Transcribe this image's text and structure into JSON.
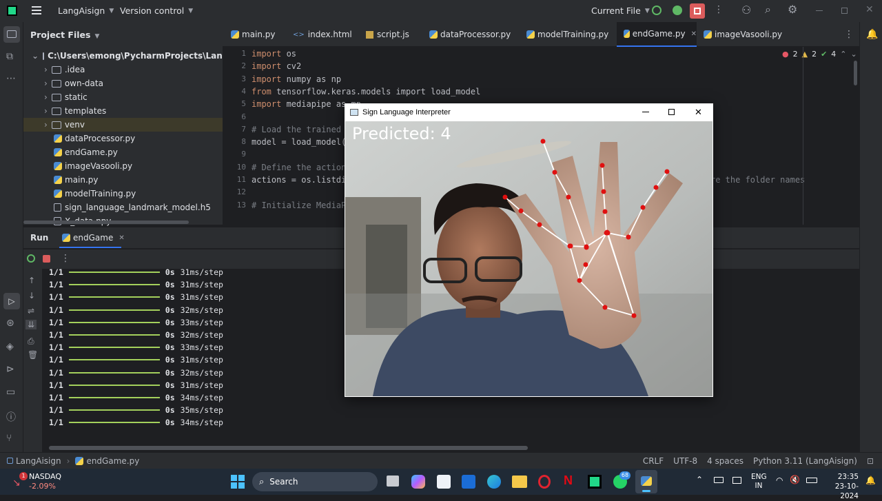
{
  "topbar": {
    "project": "LangAisign",
    "vcs": "Version control",
    "run_config": "Current File"
  },
  "project_panel": {
    "title": "Project Files",
    "root": "C:\\Users\\emong\\PycharmProjects\\LangAis",
    "folders": [
      ".idea",
      "own-data",
      "static",
      "templates",
      "venv"
    ],
    "files": [
      "dataProcessor.py",
      "endGame.py",
      "imageVasooli.py",
      "main.py",
      "modelTraining.py",
      "sign_language_landmark_model.h5",
      "X_data.npy"
    ]
  },
  "editor": {
    "tabs": [
      "main.py",
      "index.html",
      "script.js",
      "dataProcessor.py",
      "modelTraining.py",
      "endGame.py",
      "imageVasooli.py"
    ],
    "active_tab": "endGame.py",
    "inspections": {
      "errors": "2",
      "warnings": "2",
      "ok": "4"
    },
    "lines": [
      {
        "n": "1",
        "a": "import",
        "b": " os"
      },
      {
        "n": "2",
        "a": "import",
        "b": " cv2"
      },
      {
        "n": "3",
        "a": "import",
        "b": " numpy as np"
      },
      {
        "n": "4",
        "a": "from",
        "b": " tensorflow.keras.models import load_model"
      },
      {
        "n": "5",
        "a": "import",
        "b": " mediapipe as mp"
      },
      {
        "n": "6",
        "a": "",
        "b": ""
      },
      {
        "n": "7",
        "a": "",
        "b": "# Load the trained mo"
      },
      {
        "n": "8",
        "a": "",
        "b": "model = load_model(r"
      },
      {
        "n": "9",
        "a": "",
        "b": ""
      },
      {
        "n": "10",
        "a": "",
        "b": "# Define the actions"
      },
      {
        "n": "11",
        "a": "",
        "b": "actions = os.listdir"
      },
      {
        "n": "12",
        "a": "",
        "b": ""
      },
      {
        "n": "13",
        "a": "",
        "b": "# Initialize MediaPi"
      }
    ],
    "line11_tail": "re the folder names"
  },
  "run_panel": {
    "label": "Run",
    "tab": "endGame",
    "rows": [
      {
        "step": "1/1",
        "time": "0s",
        "rate": "31ms/step"
      },
      {
        "step": "1/1",
        "time": "0s",
        "rate": "31ms/step"
      },
      {
        "step": "1/1",
        "time": "0s",
        "rate": "31ms/step"
      },
      {
        "step": "1/1",
        "time": "0s",
        "rate": "32ms/step"
      },
      {
        "step": "1/1",
        "time": "0s",
        "rate": "33ms/step"
      },
      {
        "step": "1/1",
        "time": "0s",
        "rate": "32ms/step"
      },
      {
        "step": "1/1",
        "time": "0s",
        "rate": "33ms/step"
      },
      {
        "step": "1/1",
        "time": "0s",
        "rate": "31ms/step"
      },
      {
        "step": "1/1",
        "time": "0s",
        "rate": "32ms/step"
      },
      {
        "step": "1/1",
        "time": "0s",
        "rate": "31ms/step"
      },
      {
        "step": "1/1",
        "time": "0s",
        "rate": "34ms/step"
      },
      {
        "step": "1/1",
        "time": "0s",
        "rate": "35ms/step"
      },
      {
        "step": "1/1",
        "time": "0s",
        "rate": "34ms/step"
      }
    ]
  },
  "statusbar": {
    "breadcrumb_project": "LangAisign",
    "breadcrumb_file": "endGame.py",
    "line_sep": "CRLF",
    "encoding": "UTF-8",
    "indent": "4 spaces",
    "interpreter": "Python 3.11 (LangAisign)"
  },
  "sign_window": {
    "title": "Sign Language Interpreter",
    "prediction": "Predicted: 4"
  },
  "taskbar": {
    "stock_name": "NASDAQ",
    "stock_change": "-2.09%",
    "stock_badge": "1",
    "search": "Search",
    "whatsapp_badge": "68",
    "lang": "ENG",
    "region": "IN",
    "time": "23:35",
    "date": "23-10-2024"
  },
  "colors": {
    "accent": "#3574f0",
    "progress": "#a4d15c",
    "landmark": "#e01010"
  }
}
